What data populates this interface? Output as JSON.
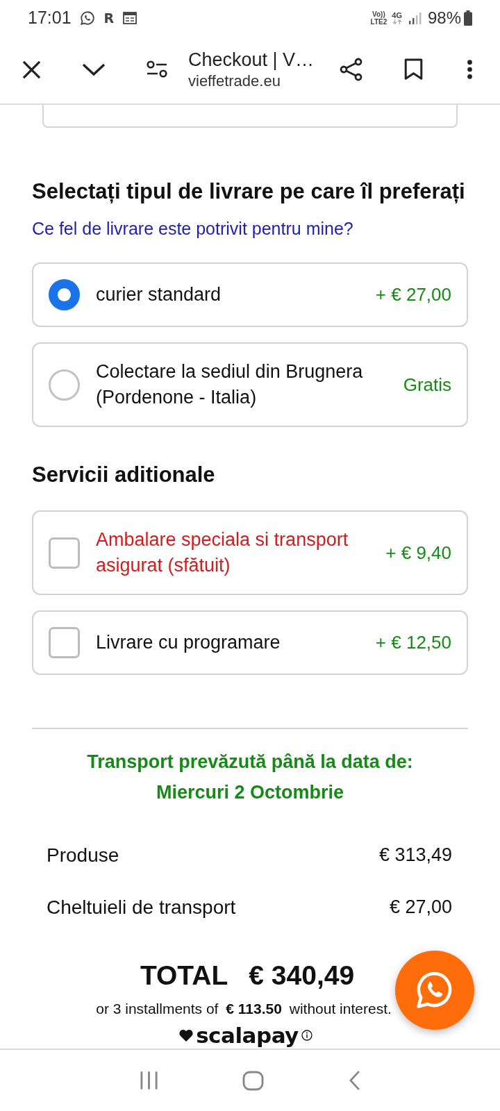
{
  "status_bar": {
    "time": "17:01",
    "app_letter": "R",
    "volte_top": "Vo))",
    "volte_bottom": "LTE2",
    "network": "4G",
    "battery": "98%"
  },
  "browser_bar": {
    "title": "Checkout | V…",
    "url": "vieffetrade.eu"
  },
  "delivery": {
    "heading": "Selectați tipul de livrare pe care îl preferați",
    "help_link": "Ce fel de livrare este potrivit pentru mine?",
    "options": [
      {
        "label": "curier standard",
        "price": "+ € 27,00",
        "selected": true
      },
      {
        "label": "Colectare la sediul din Brugnera (Pordenone - Italia)",
        "price": "Gratis",
        "selected": false
      }
    ]
  },
  "additional_services": {
    "heading": "Servicii aditionale",
    "items": [
      {
        "label": "Ambalare speciala si transport asigurat (sfătuit)",
        "price": "+ € 9,40",
        "checked": false,
        "recommended": true
      },
      {
        "label": "Livrare cu programare",
        "price": "+ € 12,50",
        "checked": false,
        "recommended": false
      }
    ]
  },
  "delivery_estimate": {
    "label": "Transport prevăzută până la data de:",
    "date": "Miercuri 2 Octombrie"
  },
  "summary": [
    {
      "label": "Produse",
      "value": "€ 313,49"
    },
    {
      "label": "Cheltuieli de transport",
      "value": "€ 27,00"
    }
  ],
  "total": {
    "label": "TOTAL",
    "value": "€ 340,49"
  },
  "installments": "or 3 installments of **€ 113.50** without interest.",
  "pay_later_logo": "scalapay"
}
